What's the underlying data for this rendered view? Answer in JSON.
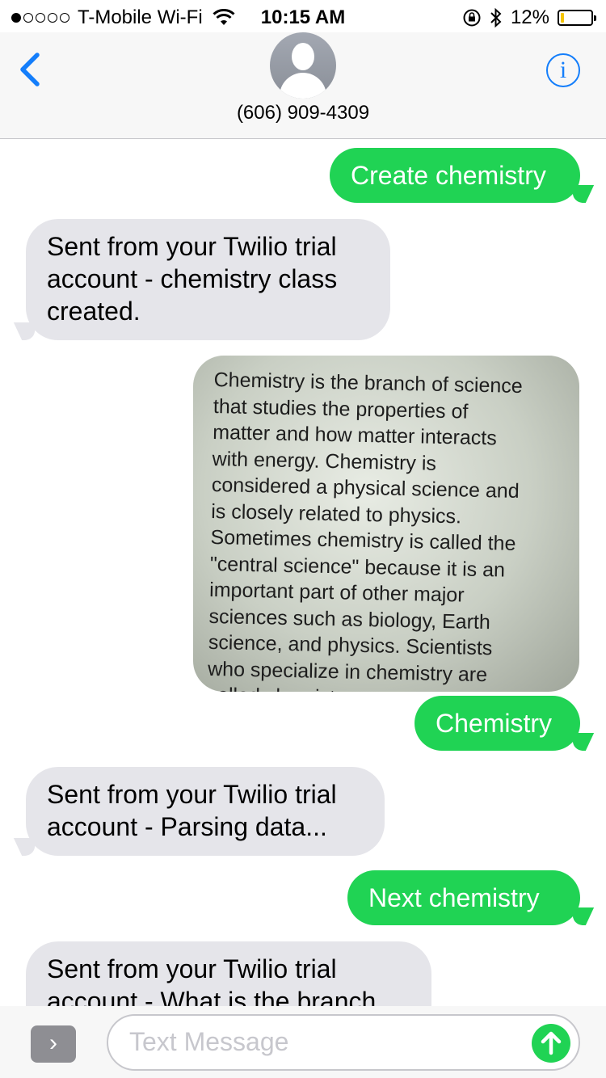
{
  "status_bar": {
    "carrier": "T-Mobile Wi-Fi",
    "time": "10:15 AM",
    "battery_percent": "12%",
    "battery_level": 0.12,
    "signal_bars_filled": 1,
    "signal_bars_total": 5,
    "icons": [
      "wifi-icon",
      "rotation-lock-icon",
      "bluetooth-icon",
      "battery-icon"
    ]
  },
  "header": {
    "contact": "(606) 909-4309",
    "back_icon": "chevron-left-icon",
    "info_label": "i"
  },
  "messages": [
    {
      "direction": "out",
      "text": "Create chemistry"
    },
    {
      "direction": "in",
      "text": "Sent from your Twilio trial account - chemistry class created."
    },
    {
      "direction": "out",
      "type": "image",
      "text": "Chemistry is the branch of science that studies the properties of matter and how matter interacts with energy. Chemistry is considered a physical science and is closely related to physics. Sometimes chemistry is called the \"central science\" because it is an important part of other major sciences such as biology, Earth science, and physics. Scientists who specialize in chemistry are called chemists."
    },
    {
      "direction": "out",
      "text": "Chemistry"
    },
    {
      "direction": "in",
      "text": "Sent from your Twilio trial account - Parsing data..."
    },
    {
      "direction": "out",
      "text": "Next chemistry"
    },
    {
      "direction": "in",
      "text": "Sent from your Twilio trial account - What is the branch"
    }
  ],
  "photo_lines": [
    "Chemistry is the branch of science",
    "that studies the properties of",
    "matter and how matter interacts",
    "with energy. Chemistry is",
    "considered a physical science and",
    "is closely related to physics.",
    "Sometimes chemistry is called the",
    "\"central science\" because it is an",
    "important part of other major",
    "sciences such as biology, Earth",
    "science, and physics. Scientists",
    "who specialize in chemistry are",
    "called chemists."
  ],
  "input": {
    "placeholder": "Text Message",
    "value": "",
    "app_button_glyph": "›"
  },
  "colors": {
    "outgoing_bubble": "#20d354",
    "incoming_bubble": "#e5e5ea",
    "accent": "#147efb"
  }
}
